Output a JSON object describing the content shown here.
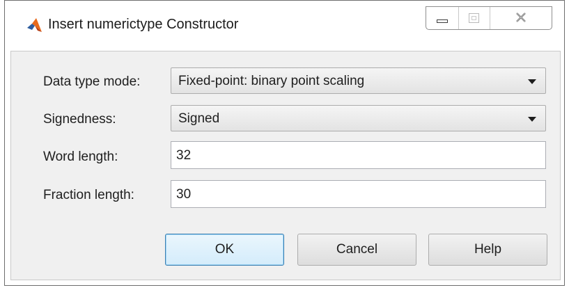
{
  "window": {
    "title": "Insert numerictype Constructor",
    "icon": "matlab-logo-icon"
  },
  "form": {
    "data_type_mode": {
      "label": "Data type mode:",
      "value": "Fixed-point: binary point scaling"
    },
    "signedness": {
      "label": "Signedness:",
      "value": "Signed"
    },
    "word_length": {
      "label": "Word length:",
      "value": "32"
    },
    "fraction_length": {
      "label": "Fraction length:",
      "value": "30"
    }
  },
  "buttons": {
    "ok": "OK",
    "cancel": "Cancel",
    "help": "Help"
  }
}
